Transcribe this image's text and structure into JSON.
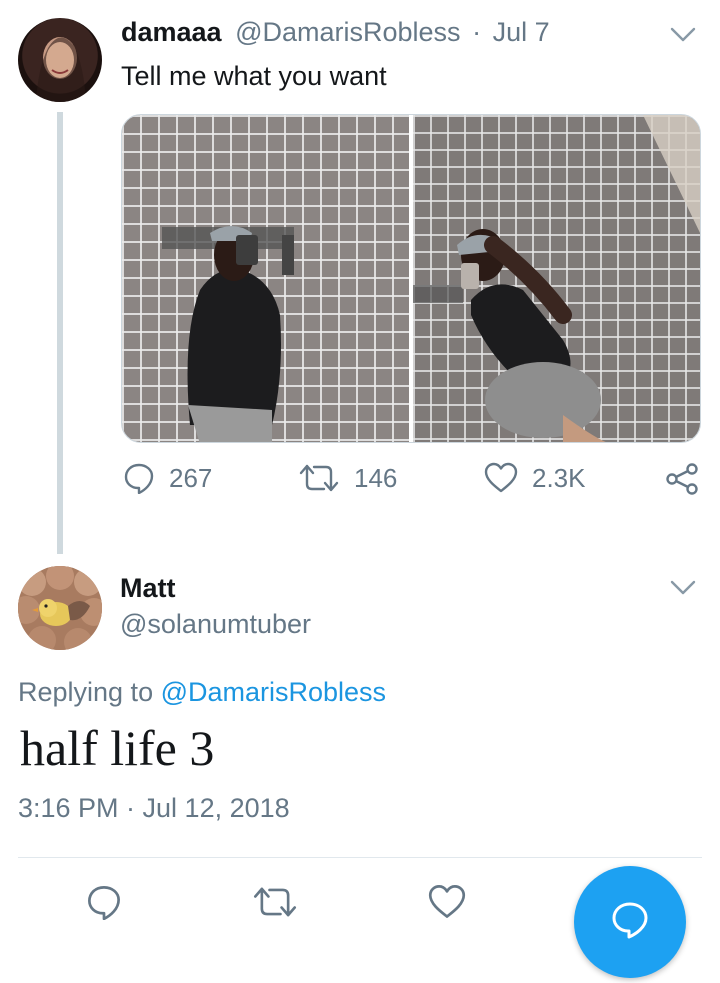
{
  "tweet": {
    "display_name": "damaaa",
    "handle": "@DamarisRobless",
    "separator": "·",
    "date": "Jul 7",
    "text": "Tell me what you want",
    "actions": {
      "replies": "267",
      "retweets": "146",
      "likes": "2.3K"
    },
    "icons": [
      "chevron-down-icon",
      "reply-icon",
      "retweet-icon",
      "heart-icon",
      "share-icon"
    ]
  },
  "reply": {
    "display_name": "Matt",
    "handle": "@solanumtuber",
    "replying_prefix": "Replying to ",
    "replying_to": "@DamarisRobless",
    "text": "half life 3",
    "timestamp": "3:16 PM · Jul 12, 2018"
  },
  "bottom_bar": {
    "icons": [
      "reply-icon",
      "retweet-icon",
      "heart-icon",
      "compose-reply-icon"
    ]
  },
  "colors": {
    "accent": "#1da1f2",
    "mention": "#1b95e0",
    "secondary_text": "#657786",
    "thread_line": "#cfd9de"
  }
}
